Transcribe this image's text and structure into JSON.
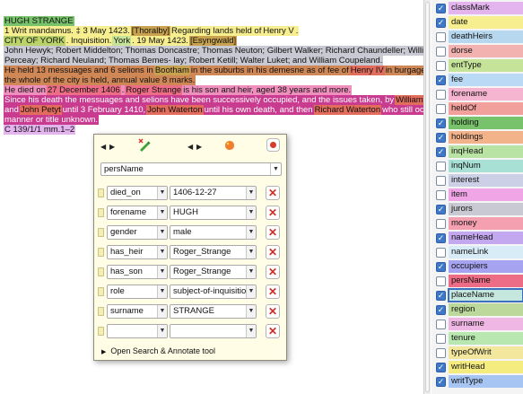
{
  "document": {
    "lines": [
      [
        {
          "t": "HUGH STRANGE",
          "c": "h-green"
        }
      ],
      [
        {
          "t": "1 Writ mandamus. ‡ 3 May 1423. ",
          "c": "h-yellow"
        },
        {
          "t": "[Thoralby]",
          "c": "h-org"
        },
        {
          "t": " Regarding lands held of ",
          "c": "h-yellow"
        },
        {
          "t": "Henry V",
          "c": "h-yellow"
        },
        {
          "t": ".",
          "c": "h-yellow"
        }
      ],
      [
        {
          "t": "CITY OF YORK",
          "c": "h-olive"
        },
        {
          "t": ". Inquisition. ",
          "c": "h-yellow"
        },
        {
          "t": "York",
          "c": "h-lime"
        },
        {
          "t": ". 19 May 1423. ",
          "c": "h-yellow"
        },
        {
          "t": "[Esyngwald]",
          "c": "h-org"
        }
      ],
      [
        {
          "t": "John Hewyk; Robert Middelton; Thomas Doncastre; Thomas Neuton; Gilbert Walker; Richard Chaundeller; William",
          "c": "h-grey"
        }
      ],
      [
        {
          "t": "Perceay; Richard Neuland; Thomas Bemes- lay; Robert Ketill; Walter Luket; and William Coupeland.",
          "c": "h-grey"
        }
      ],
      [
        {
          "t": "He held 13 messuages and 6 selions in ",
          "c": "h-brown"
        },
        {
          "t": "Bootham",
          "c": "h-org"
        },
        {
          "t": " in the suburbs in his demesne as of fee of ",
          "c": "h-brown"
        },
        {
          "t": "Henry IV",
          "c": "h-red"
        },
        {
          "t": " in burgage tenure as",
          "c": "h-brown"
        }
      ],
      [
        {
          "t": "the whole of the city is held, annual value 8 marks.",
          "c": "h-brown"
        }
      ],
      [
        {
          "t": "He died on ",
          "c": "h-pinkl"
        },
        {
          "t": "27 December 1406",
          "c": "h-rose"
        },
        {
          "t": ". ",
          "c": "h-pinkl"
        },
        {
          "t": "Roger Strange",
          "c": "h-rose"
        },
        {
          "t": " is his son and heir, aged 38 years and more.",
          "c": "h-pinkl"
        }
      ],
      [
        {
          "t": "Since his death the messuages and selions have been successively occupied, and the issues taken, by ",
          "c": "h-magenta"
        },
        {
          "t": "William de Bowes",
          "c": "h-red"
        }
      ],
      [
        {
          "t": "and ",
          "c": "h-magenta"
        },
        {
          "t": "John Petyt",
          "c": "h-red"
        },
        {
          "t": " until 3 February 1410, ",
          "c": "h-magenta"
        },
        {
          "t": "John Waterton",
          "c": "h-red"
        },
        {
          "t": " until his own death, and then ",
          "c": "h-magenta"
        },
        {
          "t": "Richard Waterton",
          "c": "h-red"
        },
        {
          "t": " who still occupies,",
          "c": "h-magenta"
        }
      ],
      [
        {
          "t": "manner or title unknown.",
          "c": "h-magenta"
        }
      ],
      [
        {
          "t": "C 139/1/1 mm.1–2",
          "c": "h-mauve"
        }
      ]
    ]
  },
  "tags": [
    {
      "label": "classMark",
      "checked": true,
      "color": "#e3b4ee"
    },
    {
      "label": "date",
      "checked": true,
      "color": "#f7ee8f"
    },
    {
      "label": "deathHeirs",
      "checked": false,
      "color": "#b7d7ee"
    },
    {
      "label": "dorse",
      "checked": false,
      "color": "#f2b2b0"
    },
    {
      "label": "entType",
      "checked": false,
      "color": "#c6e39a"
    },
    {
      "label": "fee",
      "checked": true,
      "color": "#b9d9f5"
    },
    {
      "label": "forename",
      "checked": false,
      "color": "#f5b4cf"
    },
    {
      "label": "heldOf",
      "checked": false,
      "color": "#f2a09c"
    },
    {
      "label": "holding",
      "checked": true,
      "color": "#77c26a"
    },
    {
      "label": "holdings",
      "checked": true,
      "color": "#f3b38a"
    },
    {
      "label": "inqHead",
      "checked": true,
      "color": "#b9e3a5"
    },
    {
      "label": "inqNum",
      "checked": false,
      "color": "#a9e0d6"
    },
    {
      "label": "interest",
      "checked": false,
      "color": "#cbd0e6"
    },
    {
      "label": "item",
      "checked": false,
      "color": "#f0a6e6"
    },
    {
      "label": "jurors",
      "checked": true,
      "color": "#c8c9d2"
    },
    {
      "label": "money",
      "checked": false,
      "color": "#f4a0b0"
    },
    {
      "label": "nameHead",
      "checked": true,
      "color": "#c4a8ef"
    },
    {
      "label": "nameLink",
      "checked": false,
      "color": "#d7ecf7"
    },
    {
      "label": "occupiers",
      "checked": true,
      "color": "#a6a3f0"
    },
    {
      "label": "persName",
      "checked": false,
      "color": "#ee6d86"
    },
    {
      "label": "placeName",
      "checked": true,
      "color": "#c6e7de",
      "selected": true
    },
    {
      "label": "region",
      "checked": true,
      "color": "#bcd89a"
    },
    {
      "label": "surname",
      "checked": false,
      "color": "#efb7e3"
    },
    {
      "label": "tenure",
      "checked": false,
      "color": "#b8e8b0"
    },
    {
      "label": "typeOfWrit",
      "checked": false,
      "color": "#f2e79c"
    },
    {
      "label": "writHead",
      "checked": true,
      "color": "#f5ec80"
    },
    {
      "label": "writType",
      "checked": true,
      "color": "#a7c5f2"
    }
  ],
  "popup": {
    "nav_prev": "◀",
    "nav_next": "▶",
    "nav_prev2": "◀",
    "nav_next2": "▶",
    "type_value": "persName",
    "rows": [
      {
        "attr": "died_on",
        "value": "1406-12-27"
      },
      {
        "attr": "forename",
        "value": "HUGH"
      },
      {
        "attr": "gender",
        "value": "male"
      },
      {
        "attr": "has_heir",
        "value": "Roger_Strange"
      },
      {
        "attr": "has_son",
        "value": "Roger_Strange"
      },
      {
        "attr": "role",
        "value": "subject-of-inquisition"
      },
      {
        "attr": "surname",
        "value": "STRANGE"
      },
      {
        "attr": "",
        "value": ""
      }
    ],
    "delete_label": "✕",
    "dropdown_arrow": "▼",
    "open_tool_label": "Open Search & Annotate tool",
    "open_tool_arrow": "▶"
  }
}
